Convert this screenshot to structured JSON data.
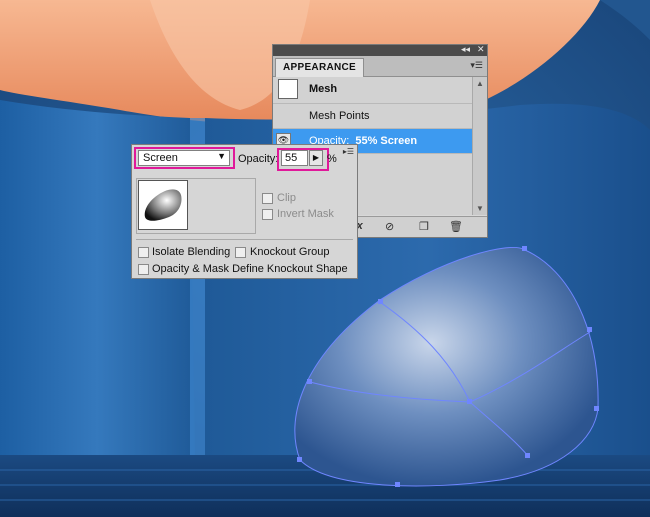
{
  "appearance_panel": {
    "tab_title": "APPEARANCE",
    "rows": [
      {
        "label": "Mesh"
      },
      {
        "label": "Mesh Points"
      },
      {
        "label": "Opacity:",
        "value": "55% Screen"
      }
    ],
    "selected_color": "#3d9af0",
    "bottom_tools": [
      "fx-icon",
      "clear-icon",
      "duplicate-icon",
      "delete-icon"
    ]
  },
  "transparency": {
    "blend_mode": "Screen",
    "opacity_label": "Opacity:",
    "opacity_value": "55",
    "percent": "%",
    "clip_label": "Clip",
    "invert_mask_label": "Invert Mask",
    "isolate_blending_label": "Isolate Blending",
    "knockout_group_label": "Knockout Group",
    "opacity_mask_label": "Opacity & Mask Define Knockout Shape",
    "highlight_color": "#e0199a"
  },
  "artwork": {
    "background_color": "#1f4f86",
    "skin_color": "#f2a478",
    "mesh_stroke": "#6f86ff"
  }
}
